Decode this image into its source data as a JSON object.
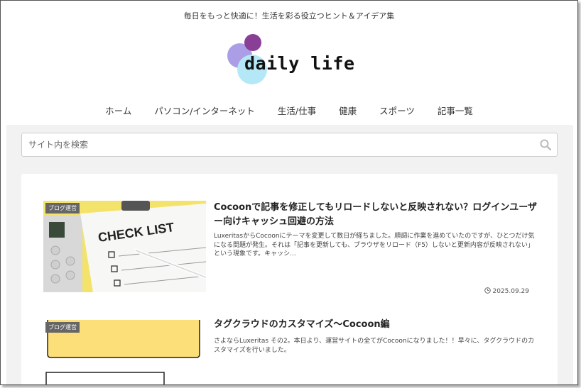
{
  "header": {
    "tagline": "毎日をもっと快適に！生活を彩る役立つヒント＆アイデア集",
    "logo_text": "daily life"
  },
  "nav": {
    "items": [
      "ホーム",
      "パソコン/インターネット",
      "生活/仕事",
      "健康",
      "スポーツ",
      "記事一覧"
    ]
  },
  "search": {
    "placeholder": "サイト内を検索",
    "icon": "search-icon"
  },
  "posts": [
    {
      "category": "ブログ運営",
      "title": "Cocoonで記事を修正してもリロードしないと反映されない？ログインユーザー向けキャッシュ回避の方法",
      "excerpt": "LuxeritasからCocoonにテーマを変更して数日が経ちました。順調に作業を進めていたのですが、ひとつだけ気になる問題が発生。それは「記事を更新しても、ブラウザをリロード（F5）しないと更新内容が反映されない」という現象です。キャッシ...",
      "date": "2025.09.29",
      "thumb_text": "CHECK LIST"
    },
    {
      "category": "ブログ運営",
      "title": "タグクラウドのカスタマイズ～Cocoon編",
      "excerpt": "さよならLuxeritas その2。本日より、運営サイトの全てがCocoonになりました！！早々に、タグクラウドのカスタマイズを行いました。"
    }
  ],
  "colors": {
    "logo_circle_1": "#ab9ee6",
    "logo_circle_2": "#8a3f96",
    "logo_circle_3": "#b5e8f7",
    "category_badge": "#666666"
  }
}
